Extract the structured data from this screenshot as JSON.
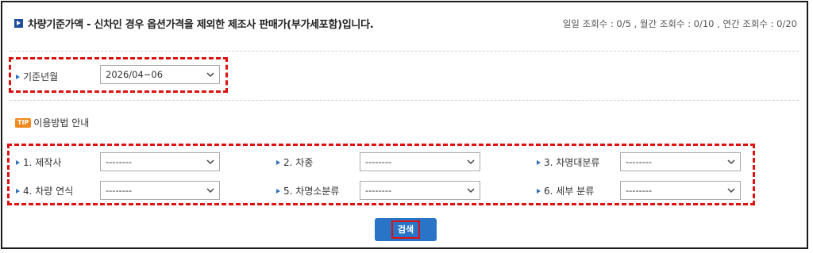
{
  "header": {
    "title": "차량기준가액 - 신차인 경우 옵션가격을 제외한 제조사 판매가(부가세포함)입니다.",
    "stats": "일일 조회수 : 0/5 , 월간 조회수 : 0/10 , 연간 조회수 : 0/20"
  },
  "base_month": {
    "label": "기준년월",
    "value": "2026/04~06"
  },
  "tip": {
    "badge": "TIP",
    "label": "이용방법 안내"
  },
  "filters": [
    {
      "label": "1. 제작사",
      "value": "--------"
    },
    {
      "label": "2. 차종",
      "value": "--------"
    },
    {
      "label": "3. 차명대분류",
      "value": "--------"
    },
    {
      "label": "4. 차량 연식",
      "value": "--------"
    },
    {
      "label": "5. 차명소분류",
      "value": "--------"
    },
    {
      "label": "6. 세부 분류",
      "value": "--------"
    }
  ],
  "search_button": "검색",
  "colors": {
    "accent": "#2a74c8",
    "highlight": "#dd1111",
    "tip_badge": "#f08a1c"
  }
}
